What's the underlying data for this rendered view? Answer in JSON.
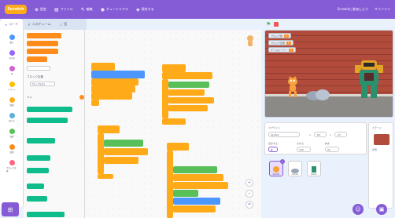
{
  "menubar": {
    "logo": "Scratch",
    "items": [
      {
        "icon": "globe-icon",
        "label": "設定"
      },
      {
        "icon": "file-icon",
        "label": "ファイル"
      },
      {
        "icon": "edit-icon",
        "label": "編集"
      },
      {
        "icon": "tutorial-icon",
        "label": "チュートリアル"
      },
      {
        "icon": "share-icon",
        "label": "保存する"
      }
    ],
    "right": [
      "Scratchに参加しよう",
      "サインイン"
    ]
  },
  "tabs": {
    "code": "コード",
    "costumes": "コスチューム",
    "sounds": "音"
  },
  "categories": [
    {
      "label": "動き",
      "color": "#4c97ff"
    },
    {
      "label": "見た目",
      "color": "#9966ff"
    },
    {
      "label": "音",
      "color": "#cf63cf"
    },
    {
      "label": "イベント",
      "color": "#ffbf00"
    },
    {
      "label": "制御",
      "color": "#ffab19"
    },
    {
      "label": "調べる",
      "color": "#5cb1d6"
    },
    {
      "label": "演算",
      "color": "#59c059"
    },
    {
      "label": "変数",
      "color": "#ff8c1a"
    },
    {
      "label": "ブロック定義",
      "color": "#ff6680"
    }
  ],
  "palette": {
    "section_my_blocks": "ブロック定義",
    "make_block": "ブロックを作る",
    "section_pen": "ペン"
  },
  "stage": {
    "monitors": [
      {
        "label": "ブロック数",
        "value": "0"
      },
      {
        "label": "ブロック定義",
        "value": "0"
      },
      {
        "label": "ゲームオーバー",
        "value": "0"
      }
    ]
  },
  "sprite_info": {
    "sprite_label": "スプライト",
    "sprite_name": "Sprite1",
    "x_label": "x",
    "x_value": "-84",
    "y_label": "y",
    "y_value": "-23",
    "show_label": "表示する",
    "size_label": "大きさ",
    "size_value": "100",
    "direction_label": "向き",
    "direction_value": "90"
  },
  "sprites": [
    {
      "name": "Sprite1"
    },
    {
      "name": "Rocks"
    },
    {
      "name": "Robot"
    }
  ],
  "stage_panel": {
    "label": "ステージ",
    "backdrops_label": "背景"
  },
  "colors": {
    "menubar": "#855cd6",
    "control": "#ffab19",
    "looks": "#9966ff",
    "motion": "#4c97ff",
    "operators": "#59c059",
    "variables": "#ff8c1a"
  }
}
